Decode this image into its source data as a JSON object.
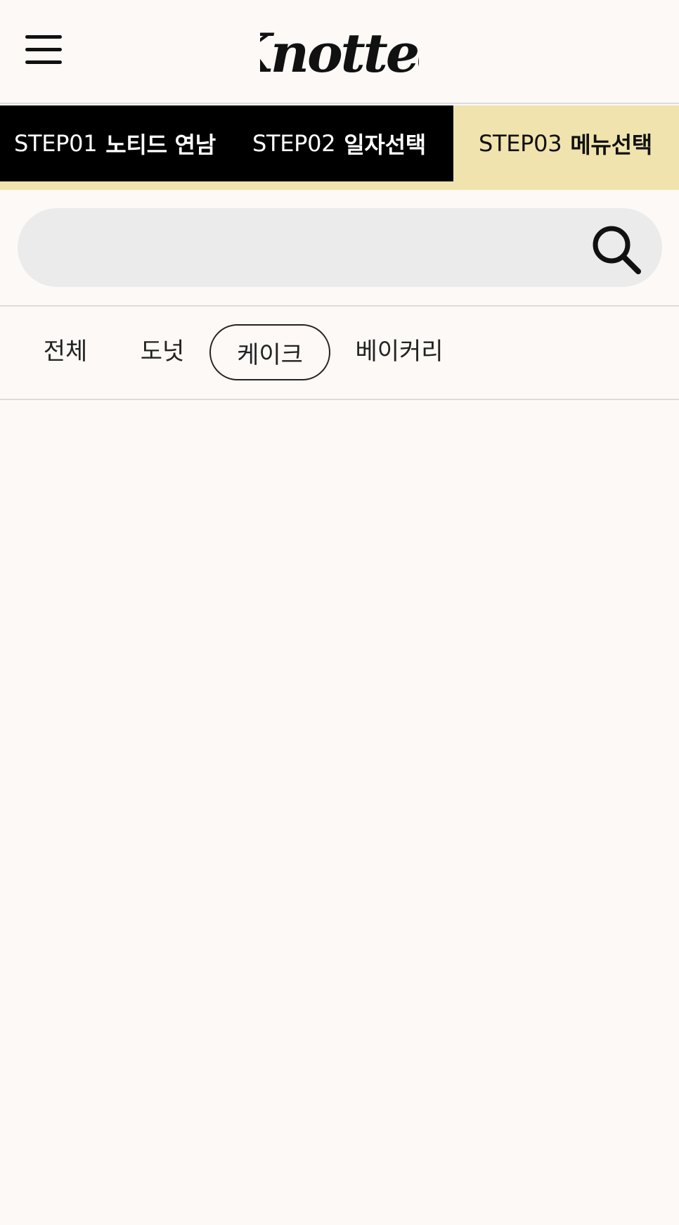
{
  "header": {
    "menu_icon": "hamburger-menu-icon",
    "logo_text": "Knotted"
  },
  "steps": [
    {
      "number": "STEP01",
      "label": "노티드 연남",
      "state": "done"
    },
    {
      "number": "STEP02",
      "label": "일자선택",
      "state": "done"
    },
    {
      "number": "STEP03",
      "label": "메뉴선택",
      "state": "current"
    }
  ],
  "search": {
    "value": "",
    "placeholder": "",
    "icon": "search-icon"
  },
  "categories": [
    {
      "label": "전체",
      "selected": false
    },
    {
      "label": "도넛",
      "selected": false
    },
    {
      "label": "케이크",
      "selected": true
    },
    {
      "label": "베이커리",
      "selected": false
    }
  ],
  "colors": {
    "background": "#fdf9f6",
    "step_active_bg": "#f0e3ad",
    "step_done_bg": "#000000",
    "search_bg": "#ebebeb"
  }
}
